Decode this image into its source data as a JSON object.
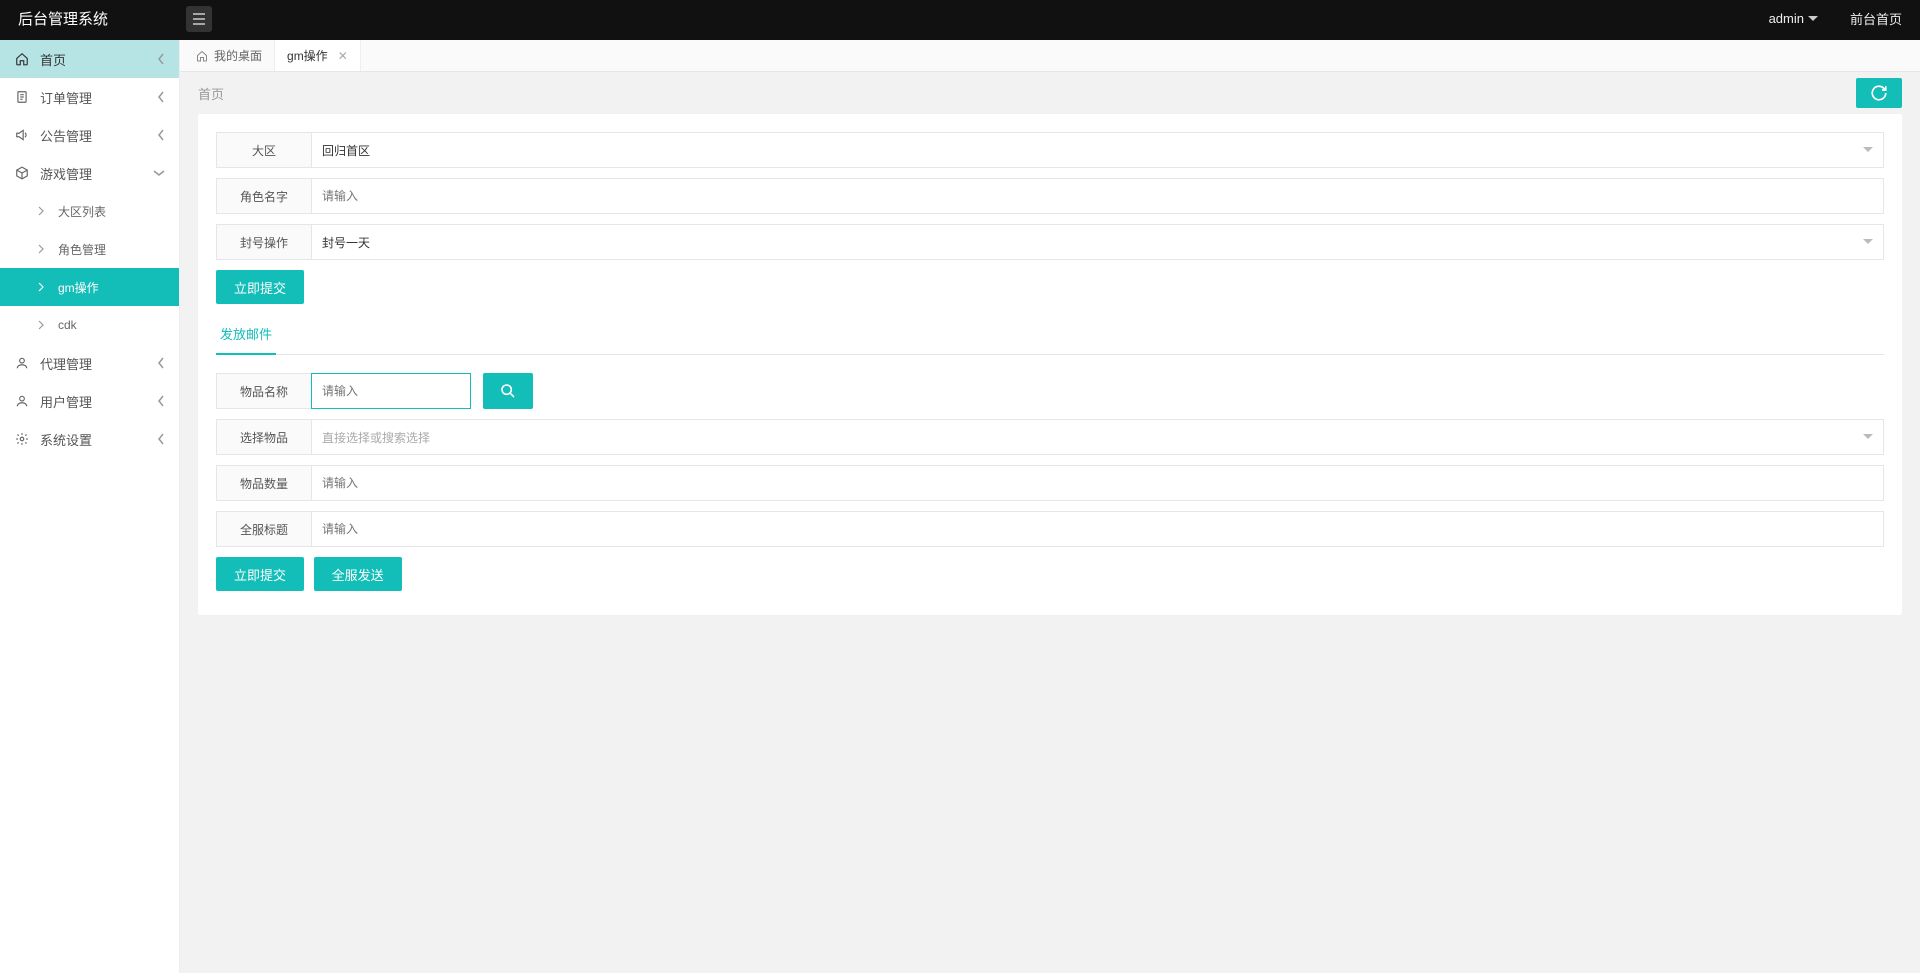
{
  "header": {
    "title": "后台管理系统",
    "user": "admin",
    "front_link": "前台首页"
  },
  "sidebar": {
    "items": [
      {
        "label": "首页",
        "icon": "home",
        "active": true,
        "expanded": false
      },
      {
        "label": "订单管理",
        "icon": "doc",
        "expanded": false
      },
      {
        "label": "公告管理",
        "icon": "speaker",
        "expanded": false
      },
      {
        "label": "游戏管理",
        "icon": "cube",
        "expanded": true,
        "children": [
          {
            "label": "大区列表"
          },
          {
            "label": "角色管理"
          },
          {
            "label": "gm操作",
            "active": true
          },
          {
            "label": "cdk"
          }
        ]
      },
      {
        "label": "代理管理",
        "icon": "user",
        "expanded": false
      },
      {
        "label": "用户管理",
        "icon": "user",
        "expanded": false
      },
      {
        "label": "系统设置",
        "icon": "gear",
        "expanded": false
      }
    ]
  },
  "tabs": [
    {
      "label": "我的桌面",
      "closable": false,
      "icon": "home"
    },
    {
      "label": "gm操作",
      "closable": true,
      "active": true
    }
  ],
  "breadcrumb": "首页",
  "form1": {
    "region_label": "大区",
    "region_value": "回归首区",
    "char_label": "角色名字",
    "char_placeholder": "请输入",
    "ban_label": "封号操作",
    "ban_value": "封号一天",
    "submit": "立即提交"
  },
  "inner_tab": "发放邮件",
  "form2": {
    "name_label": "物品名称",
    "name_placeholder": "请输入",
    "select_label": "选择物品",
    "select_placeholder": "直接选择或搜索选择",
    "qty_label": "物品数量",
    "qty_placeholder": "请输入",
    "title_label": "全服标题",
    "title_placeholder": "请输入",
    "submit": "立即提交",
    "send_all": "全服发送"
  }
}
